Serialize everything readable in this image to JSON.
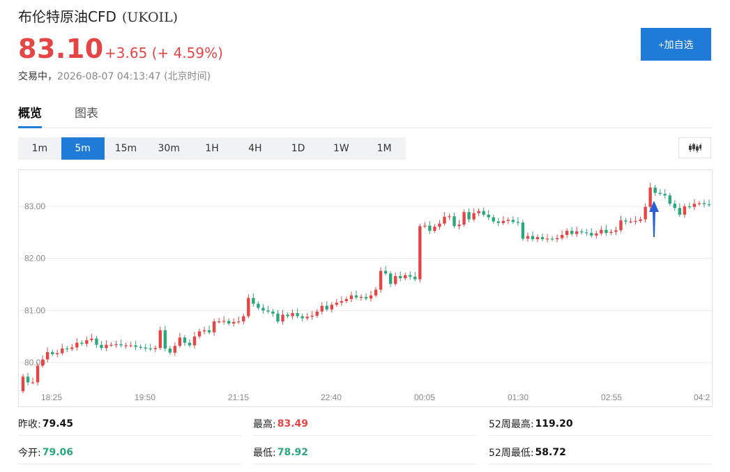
{
  "header": {
    "name": "布伦特原油CFD",
    "code": "(UKOIL)",
    "price": "83.10",
    "change": "+3.65 (+ 4.59%)",
    "status_label": "交易中，",
    "timestamp": "2026-08-07 04:13:47 (北京时间)",
    "add_button_label": "+加自选"
  },
  "tabs": [
    {
      "label": "概览",
      "active": true
    },
    {
      "label": "图表",
      "active": false
    }
  ],
  "periods": [
    {
      "label": "1m",
      "active": false
    },
    {
      "label": "5m",
      "active": true
    },
    {
      "label": "15m",
      "active": false
    },
    {
      "label": "30m",
      "active": false
    },
    {
      "label": "1H",
      "active": false
    },
    {
      "label": "4H",
      "active": false
    },
    {
      "label": "1D",
      "active": false
    },
    {
      "label": "1W",
      "active": false
    },
    {
      "label": "1M",
      "active": false
    }
  ],
  "chart_type_icon": "candlestick-icon",
  "colors": {
    "up": "#e64545",
    "down": "#2ba87a",
    "accent": "#1f7ad8",
    "marker": "#2b5fd6"
  },
  "chart_data": {
    "type": "candlestick",
    "y_ticks": [
      "83.00",
      "82.00",
      "81.00",
      "80.00"
    ],
    "y_tick_values": [
      83,
      82,
      81,
      80
    ],
    "ylim": [
      79.7,
      83.7
    ],
    "x_ticks": [
      "18:25",
      "19:50",
      "21:15",
      "22:40",
      "00:05",
      "01:30",
      "02:55",
      "04:2"
    ],
    "grid": true,
    "marker": "up-arrow",
    "closes": [
      79.73,
      79.62,
      79.62,
      79.94,
      80.06,
      80.2,
      80.16,
      80.18,
      80.27,
      80.26,
      80.29,
      80.38,
      80.36,
      80.43,
      80.46,
      80.34,
      80.28,
      80.34,
      80.34,
      80.35,
      80.33,
      80.33,
      80.33,
      80.3,
      80.29,
      80.27,
      80.26,
      80.28,
      80.62,
      80.27,
      80.19,
      80.32,
      80.48,
      80.38,
      80.33,
      80.5,
      80.6,
      80.62,
      80.58,
      80.79,
      80.79,
      80.8,
      80.75,
      80.78,
      80.79,
      80.89,
      81.24,
      81.13,
      81.05,
      81.0,
      80.98,
      80.94,
      80.79,
      80.92,
      80.89,
      80.95,
      80.89,
      80.85,
      80.88,
      80.9,
      80.98,
      81.09,
      81.02,
      81.11,
      81.15,
      81.18,
      81.22,
      81.29,
      81.25,
      81.26,
      81.23,
      81.29,
      81.4,
      81.76,
      81.71,
      81.51,
      81.66,
      81.62,
      81.68,
      81.65,
      81.6,
      82.62,
      82.63,
      82.53,
      82.61,
      82.67,
      82.8,
      82.81,
      82.62,
      82.65,
      82.89,
      82.75,
      82.87,
      82.91,
      82.84,
      82.79,
      82.71,
      82.68,
      82.72,
      82.74,
      82.7,
      82.69,
      82.38,
      82.43,
      82.37,
      82.41,
      82.37,
      82.38,
      82.37,
      82.39,
      82.45,
      82.53,
      82.47,
      82.52,
      82.5,
      82.49,
      82.44,
      82.48,
      82.55,
      82.49,
      82.51,
      82.54,
      82.73,
      82.71,
      82.71,
      82.72,
      82.75,
      82.99,
      83.36,
      83.26,
      83.24,
      83.21,
      83.05,
      82.97,
      82.84,
      83.0,
      82.99,
      83.05,
      83.06,
      83.04,
      83.03
    ]
  },
  "stats": [
    {
      "label": "昨收:",
      "value": "79.45",
      "tone": "dark"
    },
    {
      "label": "最高:",
      "value": "83.49",
      "tone": "red"
    },
    {
      "label": "52周最高:",
      "value": "119.20",
      "tone": "dark"
    },
    {
      "label": "今开:",
      "value": "79.06",
      "tone": "green"
    },
    {
      "label": "最低:",
      "value": "78.92",
      "tone": "green"
    },
    {
      "label": "52周最低:",
      "value": "58.72",
      "tone": "dark"
    }
  ]
}
